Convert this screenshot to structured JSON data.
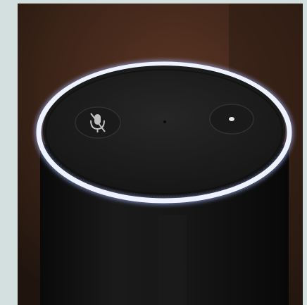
{
  "image": {
    "subject": "smart-speaker-top",
    "icons": [
      "microphone-off-icon",
      "action-dot-icon"
    ],
    "colors": {
      "background_frame": "#d4e0df",
      "wood_surface": "#4a2c1c",
      "speaker_body": "#141414",
      "light_ring": "#e8eeff",
      "ring_glow": "#9fb4ff",
      "top_plate": "#1c1c1c"
    }
  }
}
